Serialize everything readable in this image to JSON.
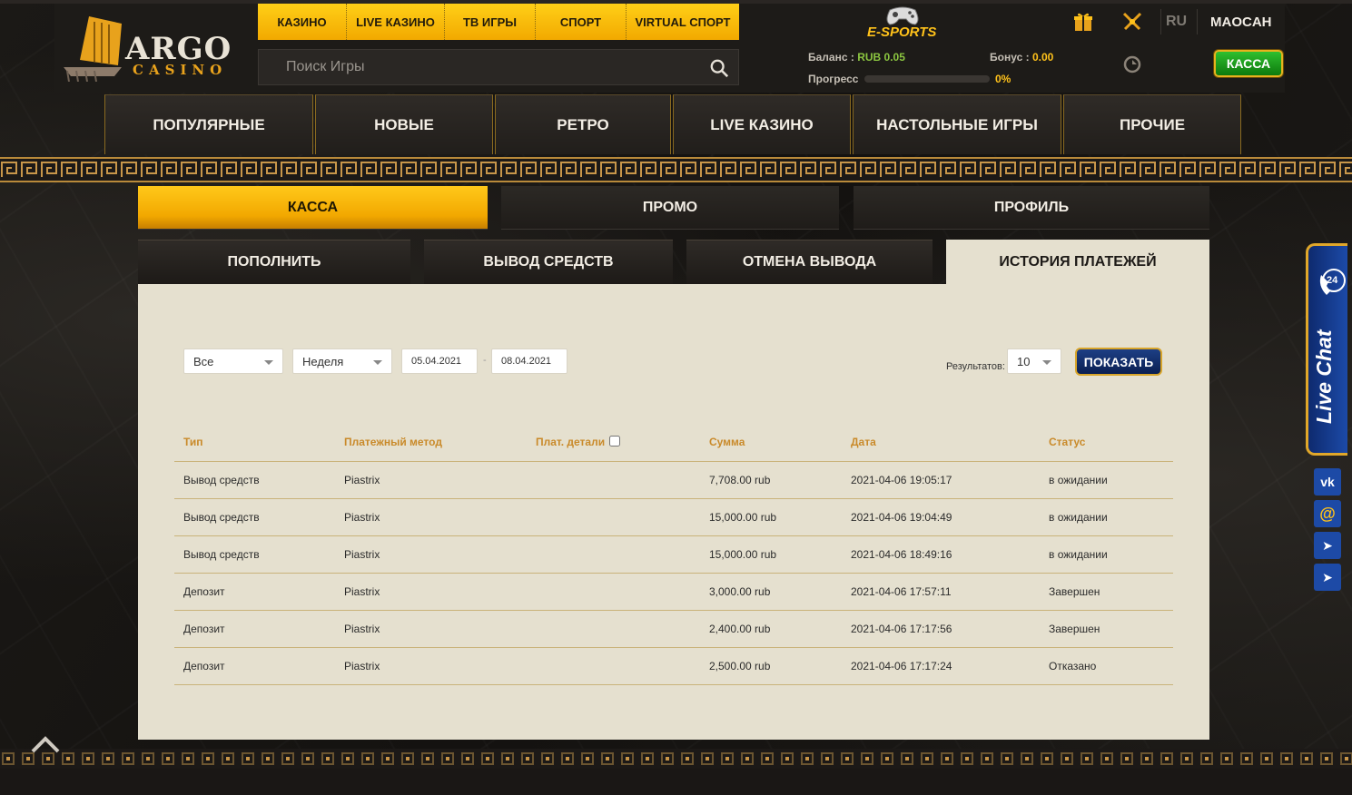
{
  "brand": {
    "name_main": "ARGO",
    "name_sub": "CASINO"
  },
  "topnav": [
    "КАЗИНО",
    "LIVE КАЗИНО",
    "ТВ ИГРЫ",
    "СПОРТ",
    "VIRTUAL СПОРТ"
  ],
  "search": {
    "placeholder": "Поиск Игры"
  },
  "esports": {
    "label": "E-SPORTS"
  },
  "header": {
    "lang": "RU",
    "username": "MAOCAH",
    "balance_label": "Баланс :",
    "balance_value": "RUB 0.05",
    "bonus_label": "Бонус :",
    "bonus_value": "0.00",
    "progress_label": "Прогресс",
    "progress_value": "0%",
    "progress_fraction": 0,
    "kassa_label": "КАССА"
  },
  "categories": [
    "ПОПУЛЯРНЫЕ",
    "НОВЫЕ",
    "РЕТРО",
    "LIVE КАЗИНО",
    "НАСТОЛЬНЫЕ ИГРЫ",
    "ПРОЧИЕ"
  ],
  "main_tabs": [
    "КАССА",
    "ПРОМО",
    "ПРОФИЛЬ"
  ],
  "sub_tabs": [
    "ПОПОЛНИТЬ",
    "ВЫВОД СРЕДСТВ",
    "ОТМЕНА ВЫВОДА",
    "ИСТОРИЯ ПЛАТЕЖЕЙ"
  ],
  "filters": {
    "type": "Все",
    "period": "Неделя",
    "date_from": "05.04.2021",
    "date_sep": "-",
    "date_to": "08.04.2021",
    "results_label": "Результатов:",
    "results_value": "10",
    "show_label": "ПОКАЗАТЬ"
  },
  "table": {
    "headers": [
      "Тип",
      "Платежный метод",
      "Плат. детали",
      "Сумма",
      "Дата",
      "Статус"
    ],
    "rows": [
      [
        "Вывод средств",
        "Piastrix",
        "",
        "7,708.00 rub",
        "2021-04-06 19:05:17",
        "в ожидании"
      ],
      [
        "Вывод средств",
        "Piastrix",
        "",
        "15,000.00 rub",
        "2021-04-06 19:04:49",
        "в ожидании"
      ],
      [
        "Вывод средств",
        "Piastrix",
        "",
        "15,000.00 rub",
        "2021-04-06 18:49:16",
        "в ожидании"
      ],
      [
        "Депозит",
        "Piastrix",
        "",
        "3,000.00 rub",
        "2021-04-06 17:57:11",
        "Завершен"
      ],
      [
        "Депозит",
        "Piastrix",
        "",
        "2,400.00 rub",
        "2021-04-06 17:17:56",
        "Завершен"
      ],
      [
        "Депозит",
        "Piastrix",
        "",
        "2,500.00 rub",
        "2021-04-06 17:17:24",
        "Отказано"
      ]
    ]
  },
  "livechat": {
    "label": "Live Chat",
    "badge": "24"
  },
  "social": [
    {
      "name": "vk",
      "glyph": "vk",
      "color": "#1d4aa6"
    },
    {
      "name": "mail",
      "glyph": "@",
      "color": "#1d4aa6"
    },
    {
      "name": "telegram",
      "glyph": "➤",
      "color": "#1d4aa6"
    },
    {
      "name": "telegram-2",
      "glyph": "➤",
      "color": "#1d4aa6"
    }
  ],
  "colors": {
    "gold": "#ffc21a",
    "accent_green": "#8bc540",
    "panel": "#e5e0cf",
    "header_text": "#c98a2a"
  }
}
